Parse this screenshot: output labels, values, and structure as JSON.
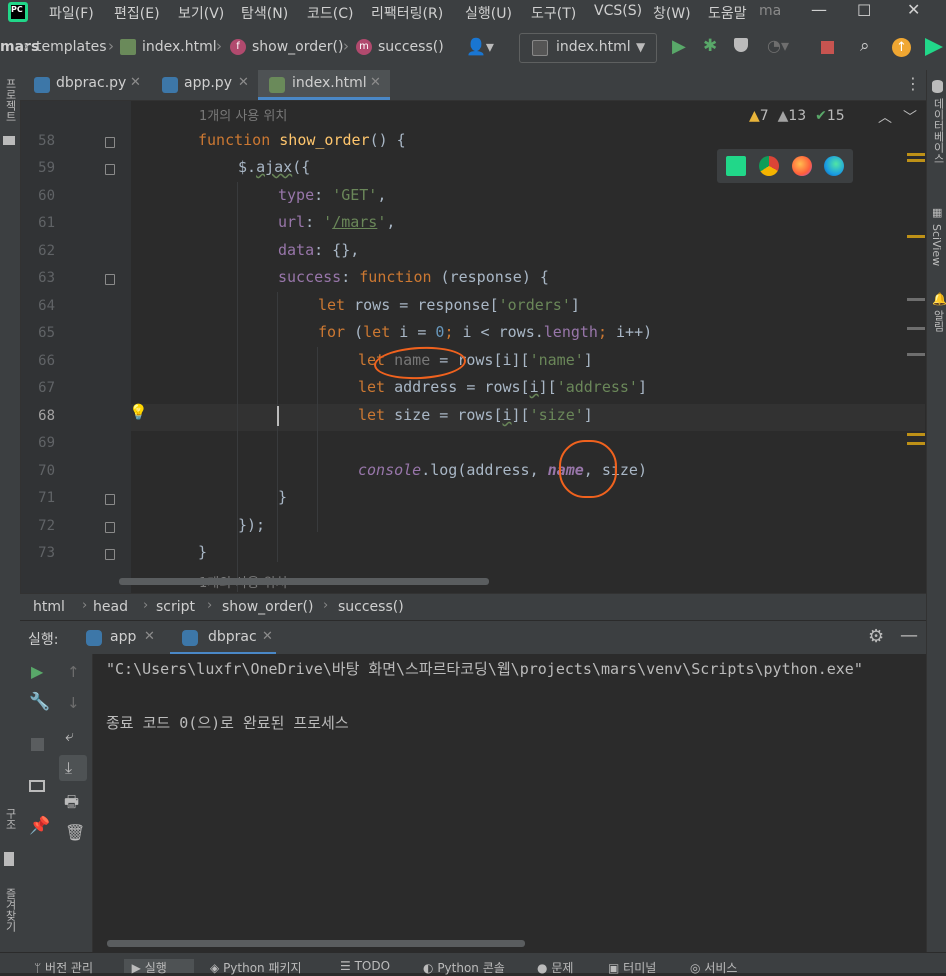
{
  "menu": {
    "items": [
      "파일(F)",
      "편집(E)",
      "보기(V)",
      "탐색(N)",
      "코드(C)",
      "리팩터링(R)",
      "실행(U)",
      "도구(T)",
      "VCS(S)",
      "창(W)",
      "도움말"
    ],
    "project_short": "ma"
  },
  "navbar": {
    "crumbs": [
      "mars",
      "templates",
      "index.html",
      "show_order()",
      "success()"
    ],
    "run_config": "index.html"
  },
  "tabs": [
    {
      "label": "dbprac.py"
    },
    {
      "label": "app.py"
    },
    {
      "label": "index.html"
    }
  ],
  "left_tools": {
    "project": "프로젝트",
    "structure": "구조",
    "bookmarks": "즐겨찾기"
  },
  "right_tools": {
    "database": "데이터베이스",
    "sciview": "SciView",
    "notifications": "알림"
  },
  "inspections": {
    "warnings": "7",
    "weak_warnings": "13",
    "typos": "15"
  },
  "editor": {
    "usage_hint_top": "1개의 사용 위치",
    "usage_hint_bottom": "1개의 사용 위치",
    "line_numbers": [
      "58",
      "59",
      "60",
      "61",
      "62",
      "63",
      "64",
      "65",
      "66",
      "67",
      "68",
      "69",
      "70",
      "71",
      "72",
      "73"
    ],
    "current_line": "68"
  },
  "code_crumbs": [
    "html",
    "head",
    "script",
    "show_order()",
    "success()"
  ],
  "run": {
    "label": "실행:",
    "tabs": [
      {
        "label": "app"
      },
      {
        "label": "dbprac"
      }
    ],
    "console": [
      "\"C:\\Users\\luxfr\\OneDrive\\바탕 화면\\스파르타코딩\\웹\\projects\\mars\\venv\\Scripts\\python.exe\"",
      "",
      "종료 코드 0(으)로 완료된 프로세스"
    ]
  },
  "bottom": {
    "items": [
      "버전 관리",
      "실행",
      "Python 패키지",
      "TODO",
      "Python 콘솔",
      "문제",
      "터미널",
      "서비스"
    ]
  },
  "colors": {
    "accent": "#4a88c7",
    "annotation": "#f0621e",
    "keyword": "#cc7832",
    "string": "#6a8759"
  }
}
